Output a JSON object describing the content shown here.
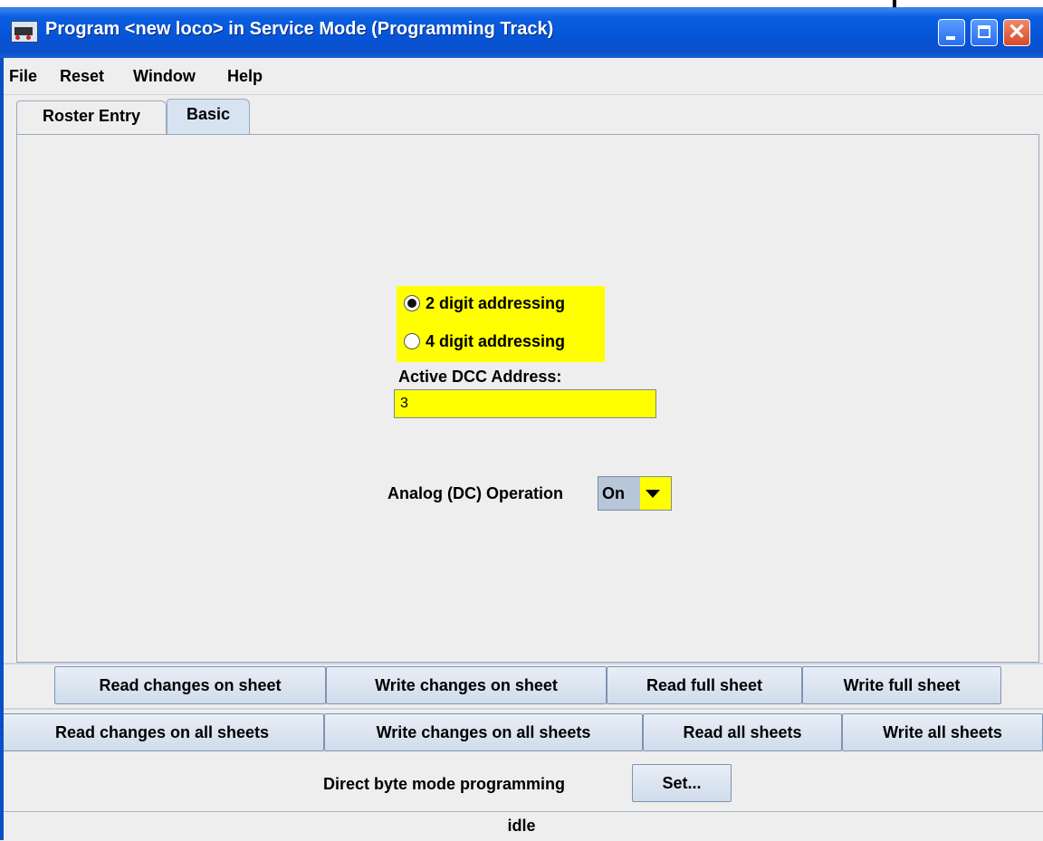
{
  "window": {
    "title": "Program <new loco> in Service Mode (Programming Track)"
  },
  "menu": [
    "File",
    "Reset",
    "Window",
    "Help"
  ],
  "tabs": [
    "Roster Entry",
    "Basic"
  ],
  "addressing": {
    "option_2": "2 digit addressing",
    "option_4": "4 digit addressing",
    "selected": "2 digit addressing"
  },
  "dcc": {
    "label": "Active DCC Address:",
    "value": "3"
  },
  "analog": {
    "label": "Analog (DC) Operation",
    "value": "On"
  },
  "sheet_buttons": [
    "Read changes on sheet",
    "Write changes on sheet",
    "Read full sheet",
    "Write full sheet"
  ],
  "all_buttons": [
    "Read changes on all sheets",
    "Write changes on all sheets",
    "Read all sheets",
    "Write all sheets"
  ],
  "mode": {
    "label": "Direct byte mode programming",
    "set_button": "Set..."
  },
  "status": "idle",
  "colors": {
    "highlight": "#ffff00",
    "titlebar": "#0655d8"
  }
}
